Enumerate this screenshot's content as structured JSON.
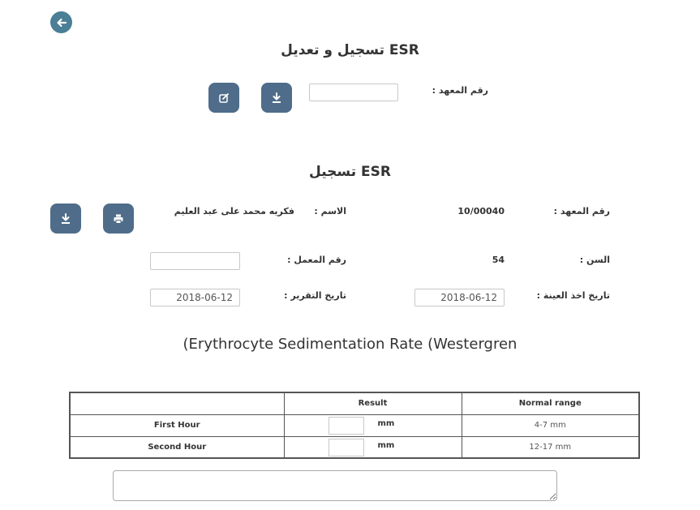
{
  "header": {
    "back_icon": "arrow-left-icon"
  },
  "search_section": {
    "title": "تسجيل و تعديل ESR",
    "institute_label": "رقم المعهد :",
    "institute_value": "",
    "download_icon": "download-icon",
    "edit_icon": "edit-icon"
  },
  "record_section": {
    "title": "تسجيل ESR",
    "institute_label": "رقم المعهد :",
    "institute_value": "10/00040",
    "name_label": "الاسم :",
    "name_value": "فكريه محمد على عبد العليم",
    "age_label": "السن :",
    "age_value": "54",
    "lab_label": "رقم المعمل :",
    "lab_value": "",
    "sample_date_label": "تاريخ اخذ العينة :",
    "sample_date_value": "2018-06-12",
    "report_date_label": "تاريخ التقرير :",
    "report_date_value": "2018-06-12",
    "print_icon": "print-icon",
    "download_icon": "download-icon"
  },
  "test": {
    "title": "(Erythrocyte Sedimentation Rate (Westergren",
    "headers": [
      "",
      "Result",
      "Normal range"
    ],
    "rows": [
      {
        "label": "First Hour",
        "result": "",
        "unit": "mm",
        "range": "4-7 mm"
      },
      {
        "label": "Second Hour",
        "result": "",
        "unit": "mm",
        "range": "12-17 mm"
      }
    ]
  },
  "notes": {
    "value": ""
  },
  "colors": {
    "button": "#4f6d8a",
    "back_button": "#4a7f96"
  }
}
